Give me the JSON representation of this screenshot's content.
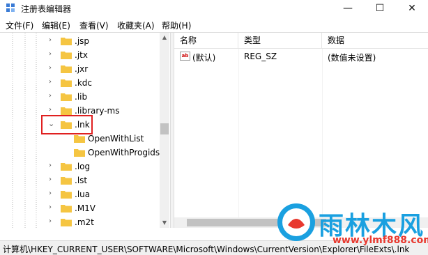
{
  "window": {
    "title": "注册表编辑器",
    "minimize": "—",
    "maximize": "☐",
    "close": "✕"
  },
  "menu": [
    "文件(F)",
    "编辑(E)",
    "查看(V)",
    "收藏夹(A)",
    "帮助(H)"
  ],
  "tree": {
    "items": [
      {
        "label": ".jsp",
        "expanded": false
      },
      {
        "label": ".jtx",
        "expanded": false
      },
      {
        "label": ".jxr",
        "expanded": false
      },
      {
        "label": ".kdc",
        "expanded": false
      },
      {
        "label": ".lib",
        "expanded": false
      },
      {
        "label": ".library-ms",
        "expanded": false
      },
      {
        "label": ".lnk",
        "expanded": true,
        "highlighted": true
      },
      {
        "label": "OpenWithList",
        "child": true
      },
      {
        "label": "OpenWithProgids",
        "child": true
      },
      {
        "label": ".log",
        "expanded": false
      },
      {
        "label": ".lst",
        "expanded": false
      },
      {
        "label": ".lua",
        "expanded": false
      },
      {
        "label": ".M1V",
        "expanded": false
      },
      {
        "label": ".m2t",
        "expanded": false
      }
    ]
  },
  "list": {
    "headers": [
      "名称",
      "类型",
      "数据"
    ],
    "rows": [
      {
        "name": "(默认)",
        "type": "REG_SZ",
        "data": "(数值未设置)"
      }
    ]
  },
  "status": {
    "path": "计算机\\HKEY_CURRENT_USER\\SOFTWARE\\Microsoft\\Windows\\CurrentVersion\\Explorer\\FileExts\\.lnk"
  },
  "watermark": {
    "title": "雨林木风",
    "url": "www.ylmf888.com"
  },
  "colors": {
    "highlight_border": "#e02020",
    "folder": "#f5c542",
    "brand_blue": "#1aa0e0",
    "brand_red": "#e8392f"
  }
}
